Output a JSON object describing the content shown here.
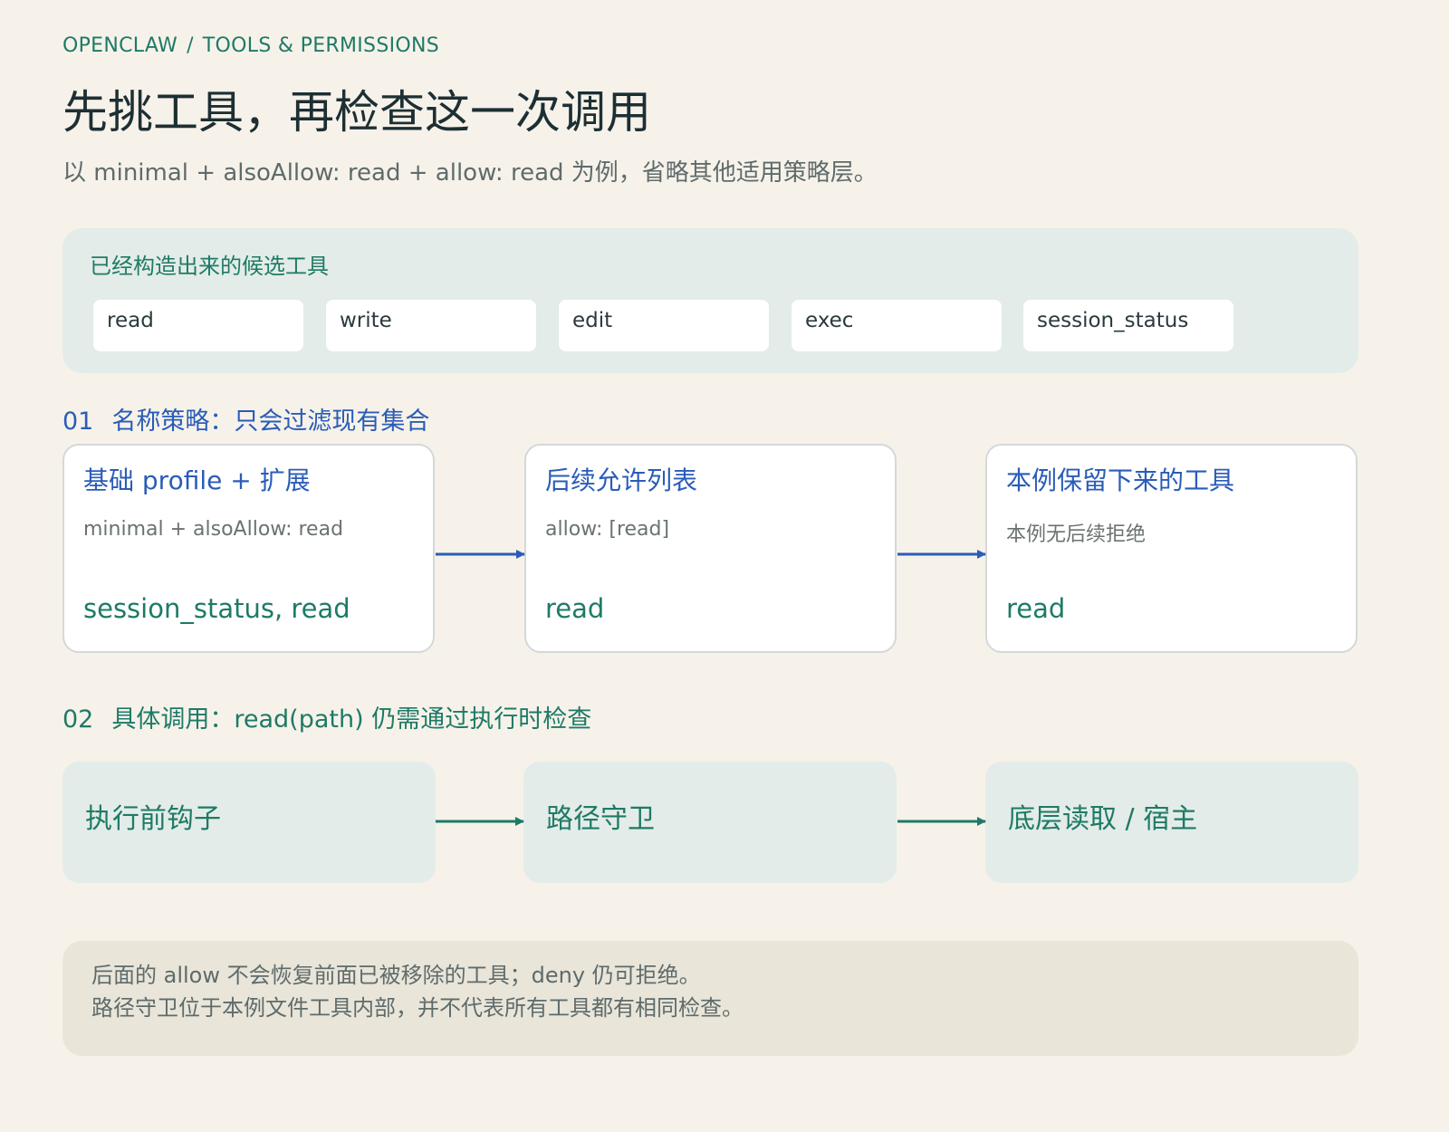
{
  "breadcrumb": {
    "app": "OPENCLAW",
    "separator": "/",
    "section": "TOOLS & PERMISSIONS"
  },
  "title": "先挑工具，再检查这一次调用",
  "subtitle": "以 minimal + alsoAllow: read + allow: read 为例，省略其他适用策略层。",
  "candidates": {
    "label": "已经构造出来的候选工具",
    "tools": [
      "read",
      "write",
      "edit",
      "exec",
      "session_status"
    ]
  },
  "section1": {
    "number": "01",
    "heading": "名称策略：只会过滤现有集合",
    "cards": [
      {
        "title": "基础 profile + 扩展",
        "desc": "minimal + alsoAllow: read",
        "result": "session_status, read"
      },
      {
        "title": "后续允许列表",
        "desc": "allow: [read]",
        "result": "read"
      },
      {
        "title": "本例保留下来的工具",
        "desc": "本例无后续拒绝",
        "result": "read"
      }
    ]
  },
  "section2": {
    "number": "02",
    "heading": "具体调用：read(path) 仍需通过执行时检查",
    "steps": [
      "执行前钩子",
      "路径守卫",
      "底层读取 / 宿主"
    ]
  },
  "note": {
    "line1": "后面的 allow 不会恢复前面已被移除的工具；deny 仍可拒绝。",
    "line2": "路径守卫位于本例文件工具内部，并不代表所有工具都有相同检查。"
  },
  "colors": {
    "background": "#f6f2ea",
    "green": "#1e7a66",
    "blue": "#2a5cb8",
    "panel": "#e3ece8",
    "note": "#e9e5d9"
  }
}
